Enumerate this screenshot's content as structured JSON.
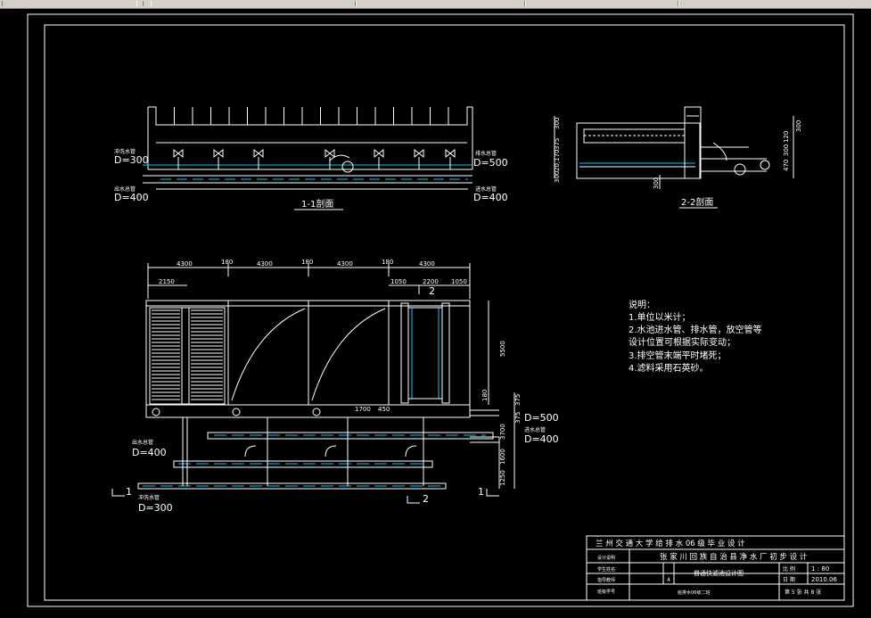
{
  "window": {
    "colors": {
      "background": "#000000",
      "lines": "#ffffff",
      "pipe_accent": "#00c8ff",
      "chrome": "#d4d0c8"
    }
  },
  "section_1_1": {
    "title": "1-1剖面",
    "left_top_label": "冲洗水管",
    "left_top_dim": "D=300",
    "left_bottom_label": "出水总管",
    "left_bottom_dim": "D=400",
    "right_top_label": "排水总管",
    "right_top_dim": "D=500",
    "right_bottom_label": "进水总管",
    "right_bottom_dim": "D=400"
  },
  "section_2_2": {
    "title": "2-2剖面",
    "dims_left": [
      "300",
      "375",
      "20,170",
      "300"
    ],
    "dims_right": [
      "300",
      "120",
      "300",
      "470"
    ],
    "dim_bottom": "300"
  },
  "plan": {
    "dims_top": [
      "4300",
      "180",
      "4300",
      "180",
      "4300",
      "180",
      "4300"
    ],
    "dim_sub_left": "2150",
    "dims_sub_right": [
      "1050",
      "2200",
      "1050"
    ],
    "section_mark_top": "2",
    "dim_right_vertical": "5500",
    "dims_right_small": [
      "180",
      "375",
      "375",
      "3700",
      "1600",
      "1250"
    ],
    "dim_inner": [
      "1700",
      "450"
    ],
    "right_top_dim": "D=500",
    "right_mid_label": "进水总管",
    "right_mid_dim": "D=400",
    "left_mid_label": "出水总管",
    "left_mid_dim": "D=400",
    "left_bottom_label": "冲洗水管",
    "left_bottom_dim": "D=300",
    "section_mark_left": "1",
    "section_mark_right": "1",
    "section_mark_bottom": "2"
  },
  "notes": {
    "heading": "说明：",
    "items": [
      "1.单位以米计；",
      "2.水池进水管、排水管，放空管等",
      "设计位置可根据实际变动；",
      "3.排空管末端平时堵死；",
      "4.滤料采用石英砂。"
    ]
  },
  "title_block": {
    "school": "兰 州 交 通 大 学 给 排 水 06 级 毕 业 设 计",
    "project": "张 家 川 回 族 自 治 县 净 水 厂 初 步 设 计",
    "drawing_name": "普通快滤池设计图",
    "row_labels": [
      "设计说明",
      "学生姓名",
      "指导教师",
      "班级学号"
    ],
    "scale_label": "比 例",
    "scale_value": "1 : 80",
    "date_label": "日 期",
    "date_value": "2010.06",
    "sheet_text": "第 5 张  共 8 张",
    "designer": "给排水06级二班",
    "small_num": "4"
  }
}
